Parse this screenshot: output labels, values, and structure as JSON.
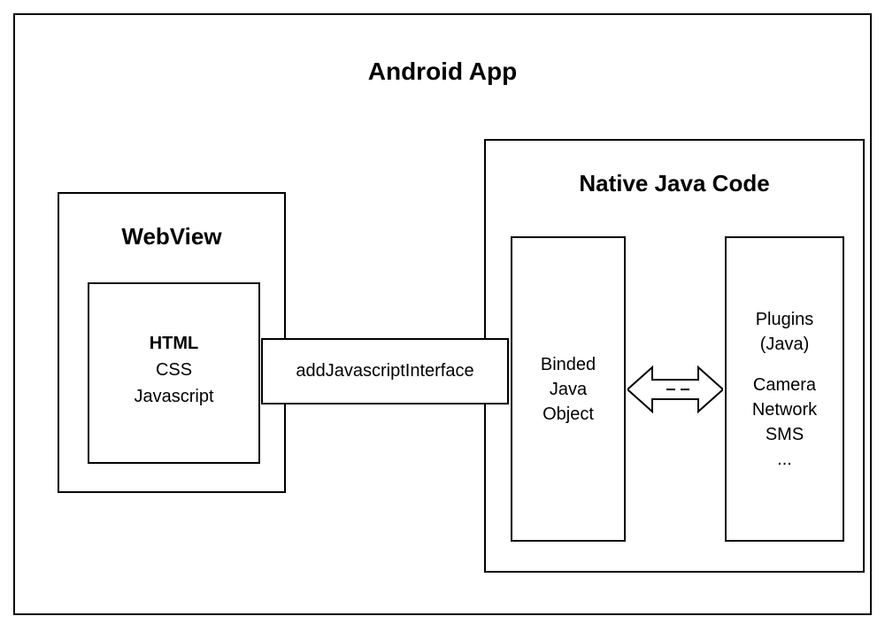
{
  "outer": {
    "title": "Android App"
  },
  "webview": {
    "title": "WebView",
    "inner_lines": {
      "l1": "HTML",
      "l2": "CSS",
      "l3": "Javascript"
    }
  },
  "connector": {
    "label": "addJavascriptInterface"
  },
  "native": {
    "title": "Native Java Code",
    "binded": {
      "l1": "Binded",
      "l2": "Java",
      "l3": "Object"
    },
    "plugins": {
      "l1": "Plugins",
      "l2": "(Java)",
      "l3": "Camera",
      "l4": "Network",
      "l5": "SMS",
      "l6": "..."
    }
  }
}
